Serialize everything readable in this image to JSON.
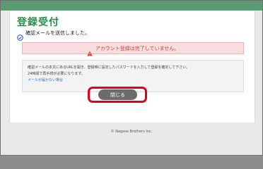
{
  "header": {
    "title": "登録受付"
  },
  "status": {
    "sent_message": "確認メールを送信しました。",
    "icon": "check-circle-icon"
  },
  "alert": {
    "message": "アカウント登録は完了していません。",
    "icon": "warning-icon",
    "color": "#d23a3a"
  },
  "info": {
    "line1": "確認メールの本文にあるURLを開き、登録時に設定したパスワードを入力して登録を確定して下さい。",
    "line2": "24時間で再手続が必要になります。",
    "link": "メールが届かない場合"
  },
  "buttons": {
    "close_label": "閉じる"
  },
  "footer": {
    "copyright": "© Nagase Brothers Inc."
  },
  "colors": {
    "accent": "#2f8a4c",
    "top_bar": "#5b9b72",
    "highlight": "#e0001b"
  }
}
